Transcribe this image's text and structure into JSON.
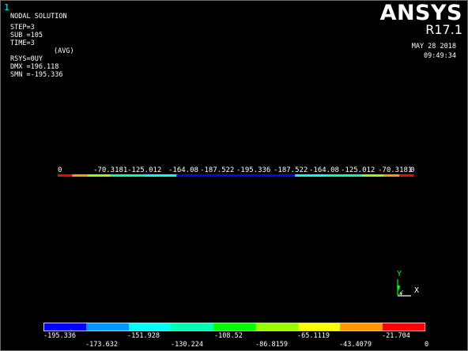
{
  "window": {
    "number": "1"
  },
  "header": {
    "solution_type": "NODAL SOLUTION",
    "step": "STEP=3",
    "sub": "SUB =105",
    "time": "TIME=3",
    "result": "UY",
    "avg": "(AVG)",
    "rsys": "RSYS=0",
    "dmx": "DMX =196.118",
    "smn": "SMN =-195.336"
  },
  "brand": {
    "name": "ANSYS",
    "version": "R17.1",
    "date": "MAY 28 2018",
    "time": "09:49:34"
  },
  "beam_labels": [
    "0",
    "-70.3181",
    "-125.012",
    "-164.08",
    "-187.522",
    "-195.336",
    "-187.522",
    "-164.08",
    "-125.012",
    "-70.3181",
    "0"
  ],
  "triad": {
    "y_label": "Y",
    "x_label": "X"
  },
  "legend": {
    "colors": [
      "#0000ff",
      "#0099ff",
      "#00ffff",
      "#00ffb2",
      "#00ff00",
      "#99ff00",
      "#ffff00",
      "#ff9900",
      "#ff0000"
    ],
    "values": [
      "-195.336",
      "-173.632",
      "-151.928",
      "-130.224",
      "-108.52",
      "-86.8159",
      "-65.1119",
      "-43.4079",
      "-21.704",
      "0"
    ]
  }
}
